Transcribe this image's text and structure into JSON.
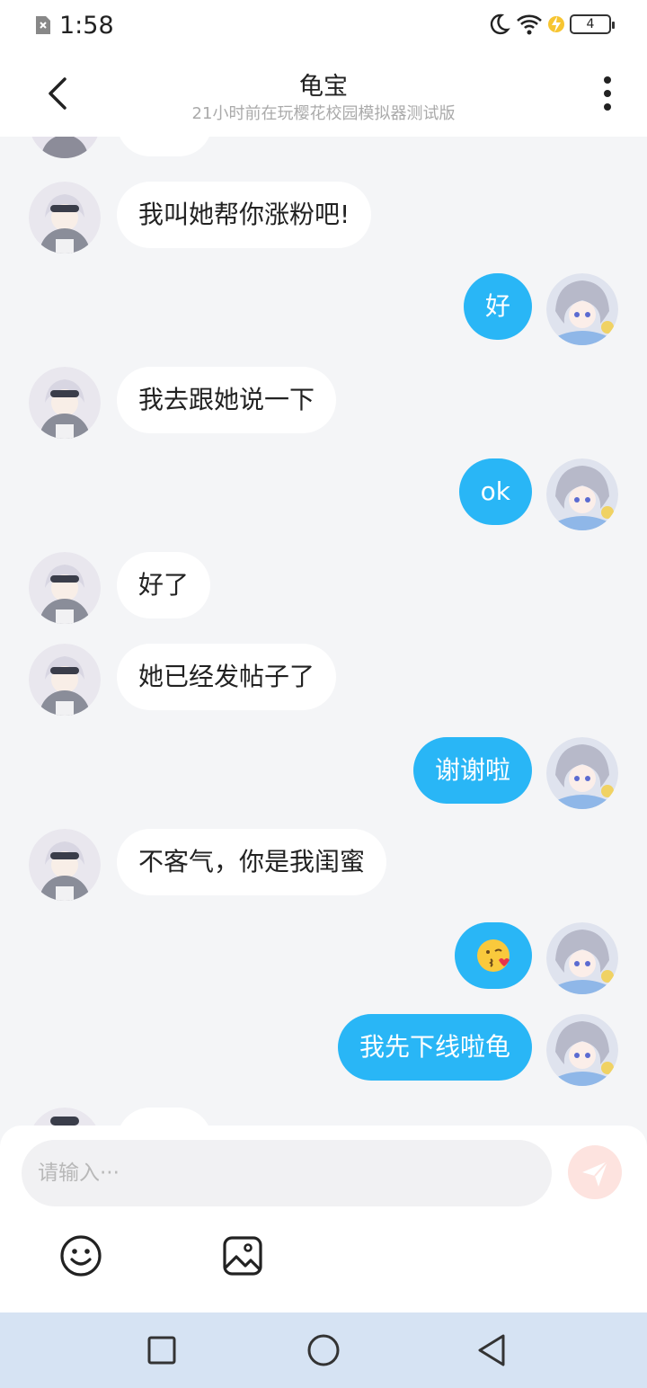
{
  "status": {
    "time": "1:58",
    "battery": "4"
  },
  "header": {
    "title": "龟宝",
    "subtitle": "21小时前在玩樱花校园模拟器测试版"
  },
  "messages": [
    {
      "side": "left",
      "text": "我叫她帮你涨粉吧!"
    },
    {
      "side": "right",
      "text": "好"
    },
    {
      "side": "left",
      "text": "我去跟她说一下"
    },
    {
      "side": "right",
      "text": "ok"
    },
    {
      "side": "left",
      "text": "好了"
    },
    {
      "side": "left",
      "text": "她已经发帖子了"
    },
    {
      "side": "right",
      "text": "谢谢啦"
    },
    {
      "side": "left",
      "text": "不客气，你是我闺蜜"
    },
    {
      "side": "right",
      "text": "😘"
    },
    {
      "side": "right",
      "text": "我先下线啦龟"
    }
  ],
  "composer": {
    "placeholder": "请输入···"
  },
  "icons": {
    "back": "chevron-left-icon",
    "more": "more-vertical-icon",
    "send": "send-icon",
    "emoji": "emoji-icon",
    "image": "image-icon",
    "nav_recent": "square-icon",
    "nav_home": "circle-icon",
    "nav_back": "triangle-back-icon"
  },
  "colors": {
    "accent": "#29b6f6",
    "bubble_left": "#ffffff",
    "send_disabled": "#fde3df",
    "nav_bg": "#d6e3f3"
  }
}
